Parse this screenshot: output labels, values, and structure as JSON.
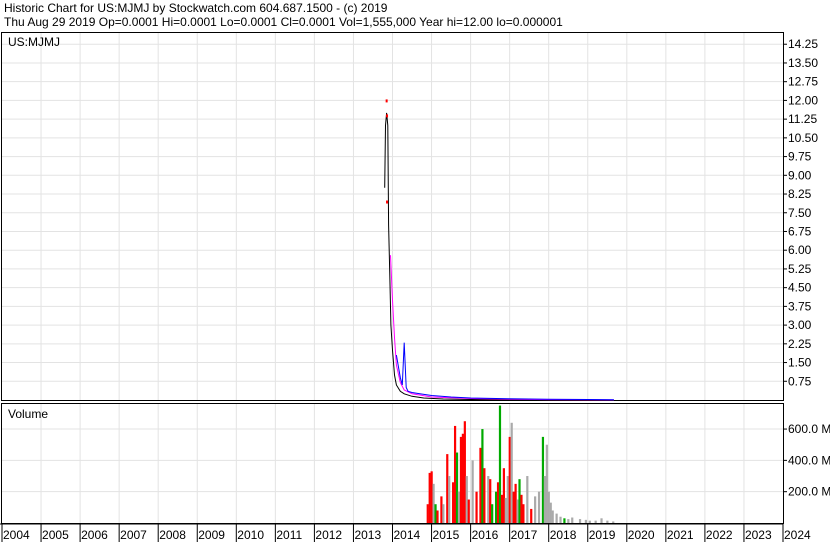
{
  "header": {
    "line1": "Historic Chart for US:MJMJ by Stockwatch.com 604.687.1500 - (c) 2019",
    "line2": "Thu Aug 29 2019   Op=0.0001   Hi=0.0001   Lo=0.0001   Cl=0.0001   Vol=1,555,000   Year hi=12.00   lo=0.000001"
  },
  "chart_data": {
    "type": "line",
    "symbol": "US:MJMJ",
    "x_ticks": [
      "2004",
      "2005",
      "2006",
      "2007",
      "2008",
      "2009",
      "2010",
      "2011",
      "2012",
      "2013",
      "2014",
      "2015",
      "2016",
      "2017",
      "2018",
      "2019",
      "2020",
      "2021",
      "2022",
      "2023",
      "2024"
    ],
    "xlim": [
      2004,
      2024
    ],
    "price": {
      "ylim": [
        0,
        14.7
      ],
      "y_ticks": [
        "14.25",
        "13.50",
        "12.75",
        "12.00",
        "11.25",
        "10.50",
        "9.75",
        "9.00",
        "8.25",
        "7.50",
        "6.75",
        "6.00",
        "5.25",
        "4.50",
        "3.75",
        "3.00",
        "2.25",
        "1.50",
        "0.75"
      ],
      "series": [
        {
          "color": "#000000",
          "x": [
            2013.8,
            2013.82,
            2013.85,
            2013.88,
            2013.9,
            2013.93,
            2013.96,
            2014.0,
            2014.05,
            2014.1,
            2014.2,
            2014.3,
            2014.5,
            2014.8,
            2015.3,
            2016.0,
            2017.0,
            2018.0,
            2019.0,
            2019.67
          ],
          "y": [
            8.5,
            11.0,
            11.5,
            11.0,
            7.0,
            5.0,
            3.0,
            2.0,
            1.0,
            0.6,
            0.35,
            0.25,
            0.15,
            0.08,
            0.04,
            0.02,
            0.01,
            0.005,
            0.002,
            0.0001
          ]
        },
        {
          "color": "#ff00ff",
          "x": [
            2013.95,
            2014.0,
            2014.05,
            2014.1,
            2014.2,
            2014.3,
            2014.5,
            2015.0,
            2016.0,
            2017.0,
            2018.0,
            2019.0,
            2019.67
          ],
          "y": [
            5.8,
            4.0,
            2.5,
            1.4,
            0.7,
            0.4,
            0.25,
            0.12,
            0.06,
            0.03,
            0.015,
            0.008,
            0.005
          ]
        },
        {
          "color": "#0000ff",
          "x": [
            2014.1,
            2014.2,
            2014.25,
            2014.3,
            2014.35,
            2014.4,
            2014.5,
            2014.7,
            2015.0,
            2015.5,
            2016.0,
            2017.0,
            2018.0,
            2019.0,
            2019.67
          ],
          "y": [
            1.8,
            0.9,
            0.6,
            2.3,
            0.5,
            0.35,
            0.3,
            0.25,
            0.18,
            0.12,
            0.08,
            0.05,
            0.03,
            0.02,
            0.01
          ]
        }
      ],
      "highlights": [
        {
          "color": "#ff0000",
          "x": 2013.85,
          "y": 12.0
        },
        {
          "color": "#ff0000",
          "x": 2013.86,
          "y": 11.4
        },
        {
          "color": "#ff0000",
          "x": 2013.86,
          "y": 7.95
        }
      ]
    },
    "volume": {
      "title": "Volume",
      "ylim": [
        0,
        760
      ],
      "y_ticks": [
        "600.0 M",
        "400.0 M",
        "200.0 M"
      ],
      "bars": [
        {
          "x": 2014.9,
          "v": 120,
          "c": "#ff0000"
        },
        {
          "x": 2014.95,
          "v": 320,
          "c": "#ff0000"
        },
        {
          "x": 2015.0,
          "v": 330,
          "c": "#ff0000"
        },
        {
          "x": 2015.05,
          "v": 250,
          "c": "#aaaaaa"
        },
        {
          "x": 2015.1,
          "v": 120,
          "c": "#00aa00"
        },
        {
          "x": 2015.15,
          "v": 80,
          "c": "#ff0000"
        },
        {
          "x": 2015.25,
          "v": 170,
          "c": "#ff0000"
        },
        {
          "x": 2015.3,
          "v": 120,
          "c": "#aaaaaa"
        },
        {
          "x": 2015.4,
          "v": 440,
          "c": "#ff0000"
        },
        {
          "x": 2015.45,
          "v": 300,
          "c": "#aaaaaa"
        },
        {
          "x": 2015.55,
          "v": 260,
          "c": "#ff0000"
        },
        {
          "x": 2015.6,
          "v": 620,
          "c": "#ff0000"
        },
        {
          "x": 2015.65,
          "v": 450,
          "c": "#00aa00"
        },
        {
          "x": 2015.7,
          "v": 200,
          "c": "#aaaaaa"
        },
        {
          "x": 2015.75,
          "v": 550,
          "c": "#ff0000"
        },
        {
          "x": 2015.8,
          "v": 570,
          "c": "#ff0000"
        },
        {
          "x": 2015.85,
          "v": 650,
          "c": "#ff0000"
        },
        {
          "x": 2015.9,
          "v": 300,
          "c": "#aaaaaa"
        },
        {
          "x": 2015.95,
          "v": 150,
          "c": "#ff0000"
        },
        {
          "x": 2016.05,
          "v": 400,
          "c": "#aaaaaa"
        },
        {
          "x": 2016.15,
          "v": 200,
          "c": "#ff0000"
        },
        {
          "x": 2016.25,
          "v": 480,
          "c": "#ff0000"
        },
        {
          "x": 2016.3,
          "v": 600,
          "c": "#00aa00"
        },
        {
          "x": 2016.35,
          "v": 350,
          "c": "#ff0000"
        },
        {
          "x": 2016.45,
          "v": 300,
          "c": "#aaaaaa"
        },
        {
          "x": 2016.5,
          "v": 280,
          "c": "#ff0000"
        },
        {
          "x": 2016.55,
          "v": 120,
          "c": "#00aa00"
        },
        {
          "x": 2016.65,
          "v": 200,
          "c": "#00aa00"
        },
        {
          "x": 2016.7,
          "v": 260,
          "c": "#ff0000"
        },
        {
          "x": 2016.75,
          "v": 750,
          "c": "#00aa00"
        },
        {
          "x": 2016.8,
          "v": 180,
          "c": "#ff0000"
        },
        {
          "x": 2016.85,
          "v": 350,
          "c": "#ff0000"
        },
        {
          "x": 2016.9,
          "v": 160,
          "c": "#aaaaaa"
        },
        {
          "x": 2016.95,
          "v": 300,
          "c": "#aaaaaa"
        },
        {
          "x": 2017.0,
          "v": 550,
          "c": "#ff0000"
        },
        {
          "x": 2017.05,
          "v": 640,
          "c": "#aaaaaa"
        },
        {
          "x": 2017.1,
          "v": 200,
          "c": "#ff0000"
        },
        {
          "x": 2017.15,
          "v": 250,
          "c": "#ff0000"
        },
        {
          "x": 2017.2,
          "v": 150,
          "c": "#aaaaaa"
        },
        {
          "x": 2017.25,
          "v": 280,
          "c": "#00aa00"
        },
        {
          "x": 2017.3,
          "v": 180,
          "c": "#ff0000"
        },
        {
          "x": 2017.35,
          "v": 120,
          "c": "#ff0000"
        },
        {
          "x": 2017.45,
          "v": 300,
          "c": "#aaaaaa"
        },
        {
          "x": 2017.55,
          "v": 90,
          "c": "#ff0000"
        },
        {
          "x": 2017.65,
          "v": 170,
          "c": "#aaaaaa"
        },
        {
          "x": 2017.75,
          "v": 200,
          "c": "#aaaaaa"
        },
        {
          "x": 2017.85,
          "v": 550,
          "c": "#00aa00"
        },
        {
          "x": 2017.9,
          "v": 300,
          "c": "#aaaaaa"
        },
        {
          "x": 2017.95,
          "v": 500,
          "c": "#aaaaaa"
        },
        {
          "x": 2018.0,
          "v": 200,
          "c": "#aaaaaa"
        },
        {
          "x": 2018.05,
          "v": 130,
          "c": "#aaaaaa"
        },
        {
          "x": 2018.1,
          "v": 80,
          "c": "#aaaaaa"
        },
        {
          "x": 2018.2,
          "v": 60,
          "c": "#aaaaaa"
        },
        {
          "x": 2018.3,
          "v": 40,
          "c": "#aaaaaa"
        },
        {
          "x": 2018.4,
          "v": 30,
          "c": "#00aa00"
        },
        {
          "x": 2018.5,
          "v": 25,
          "c": "#aaaaaa"
        },
        {
          "x": 2018.6,
          "v": 35,
          "c": "#aaaaaa"
        },
        {
          "x": 2018.8,
          "v": 25,
          "c": "#aaaaaa"
        },
        {
          "x": 2018.95,
          "v": 20,
          "c": "#aaaaaa"
        },
        {
          "x": 2019.05,
          "v": 15,
          "c": "#aaaaaa"
        },
        {
          "x": 2019.2,
          "v": 15,
          "c": "#aaaaaa"
        },
        {
          "x": 2019.35,
          "v": 30,
          "c": "#aaaaaa"
        },
        {
          "x": 2019.5,
          "v": 15,
          "c": "#aaaaaa"
        },
        {
          "x": 2019.65,
          "v": 10,
          "c": "#aaaaaa"
        }
      ]
    }
  },
  "colors": {
    "grid": "#e3e3e3",
    "axis": "#000000"
  }
}
